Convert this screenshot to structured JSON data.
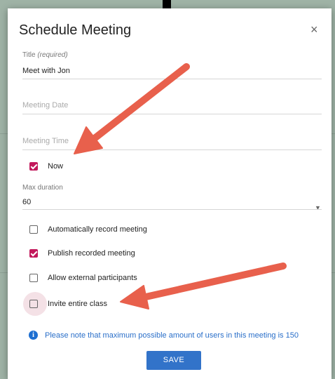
{
  "dialog": {
    "title": "Schedule Meeting",
    "close_symbol": "×",
    "title_field": {
      "label": "Title",
      "required_note": "(required)",
      "value": "Meet with Jon"
    },
    "meeting_date": {
      "placeholder": "Meeting Date"
    },
    "meeting_time": {
      "placeholder": "Meeting Time"
    },
    "now_checkbox": {
      "label": "Now",
      "checked": true
    },
    "max_duration": {
      "label": "Max duration",
      "value": "60",
      "arrow": "▼"
    },
    "options": [
      {
        "label": "Automatically record meeting",
        "checked": false
      },
      {
        "label": "Publish recorded meeting",
        "checked": true
      },
      {
        "label": "Allow external participants",
        "checked": false
      },
      {
        "label": "Invite entire class",
        "checked": false
      }
    ],
    "info": {
      "icon": "i",
      "text": "Please note that maximum possible amount of users in this meeting is 150"
    },
    "save_label": "SAVE"
  },
  "colors": {
    "accent_checkbox": "#c2185b",
    "primary_button": "#3273c9",
    "info_text": "#2a6fc9",
    "annotation_arrow": "#e8604c"
  }
}
